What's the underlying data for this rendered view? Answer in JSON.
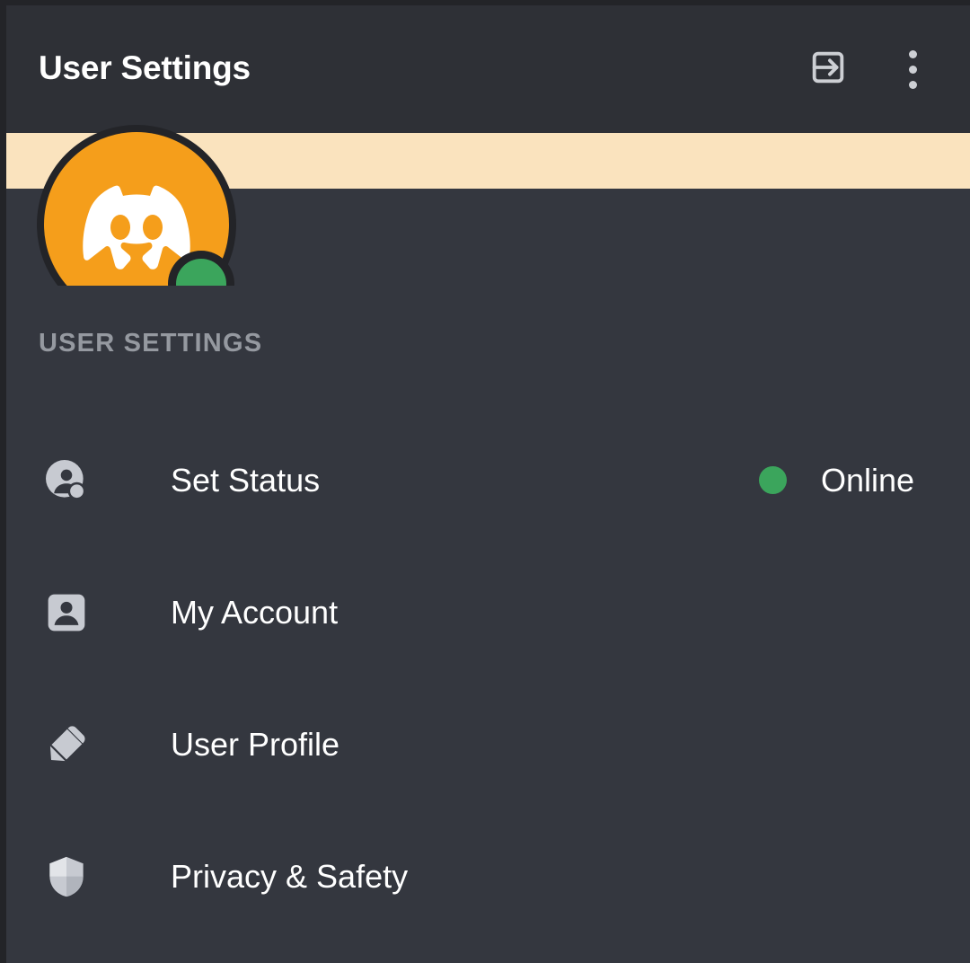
{
  "header": {
    "title": "User Settings",
    "logout_icon": "logout-arrow-icon",
    "overflow_icon": "more-vertical-icon"
  },
  "profile": {
    "avatar_icon": "discord-clyde-logo",
    "avatar_color": "#f59e1b",
    "banner_color": "#fae3be",
    "presence_color": "#3ba55c",
    "presence": "Online"
  },
  "section": {
    "label": "USER SETTINGS"
  },
  "menu": {
    "items": [
      {
        "label": "Set Status",
        "icon": "person-status-icon",
        "trailing_text": "Online",
        "trailing_dot_color": "#3ba55c"
      },
      {
        "label": "My Account",
        "icon": "account-card-icon",
        "trailing_text": "",
        "trailing_dot_color": ""
      },
      {
        "label": "User Profile",
        "icon": "pencil-edit-icon",
        "trailing_text": "",
        "trailing_dot_color": ""
      },
      {
        "label": "Privacy & Safety",
        "icon": "shield-icon",
        "trailing_text": "",
        "trailing_dot_color": ""
      }
    ]
  },
  "colors": {
    "header_bg": "#2e3036",
    "body_bg": "#34373f",
    "gutter": "#232428",
    "icon_gray": "#c7cad1",
    "label_gray": "#9599a0"
  }
}
